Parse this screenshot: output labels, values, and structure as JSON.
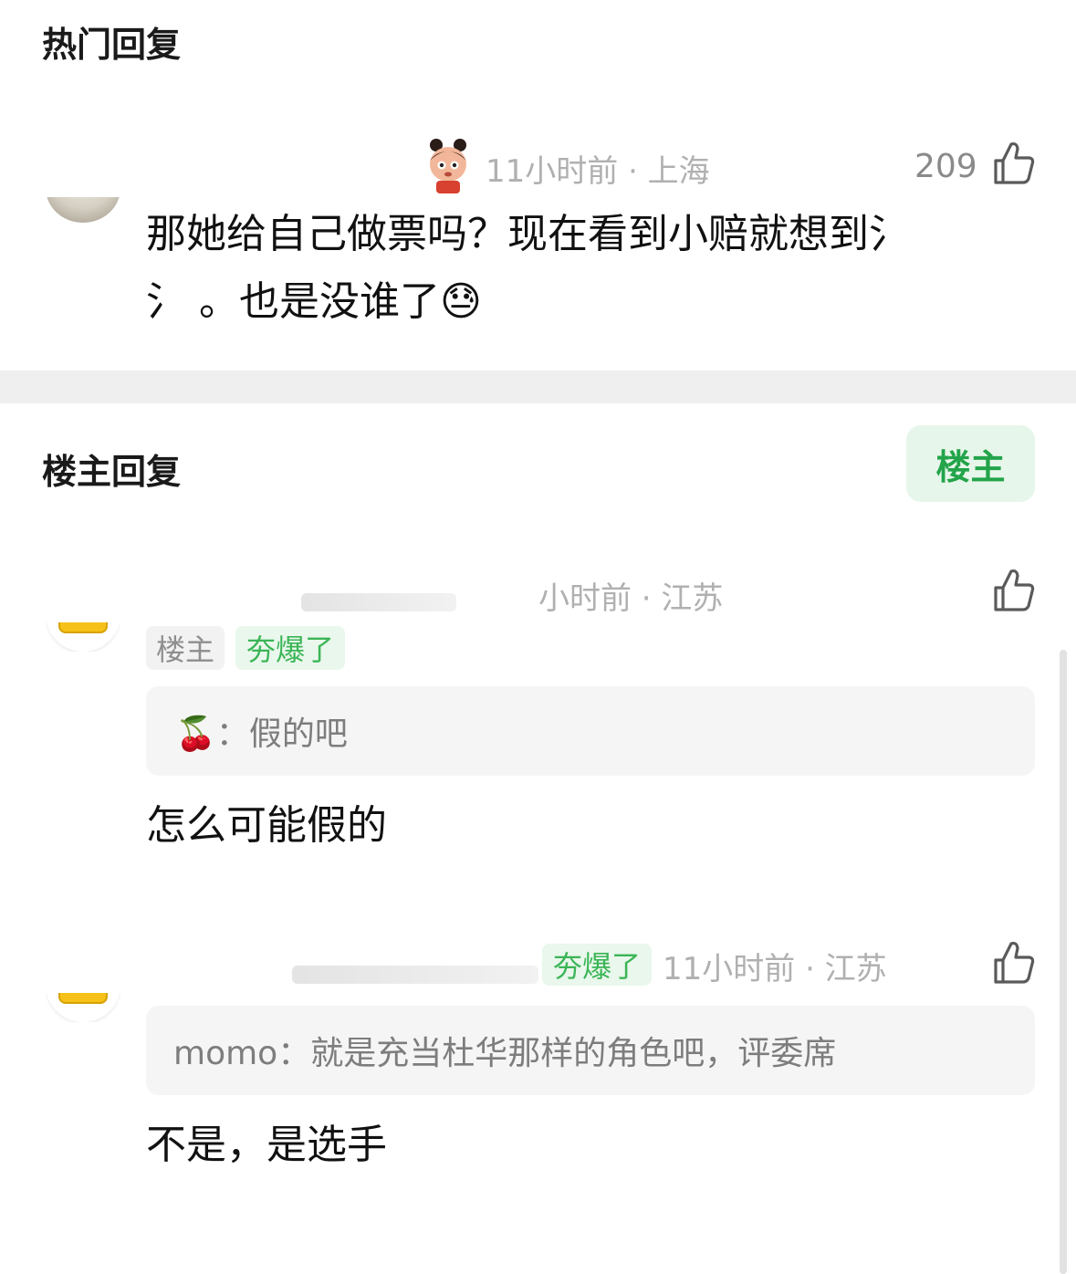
{
  "hot_section": {
    "title": "热门回复",
    "comment": {
      "meta": "11小时前 · 上海",
      "likes": "209",
      "text_line1": "那她给自己做票吗？现在看到小赔就想到氵",
      "text_line2": "氵 。也是没谁了😓"
    }
  },
  "op_section": {
    "title": "楼主回复",
    "filter_button": "楼主",
    "replies": [
      {
        "meta": "小时前 · 江苏",
        "tag_op": "楼主",
        "tag_badge": "夯爆了",
        "quote_text": "🍒：假的吧",
        "text": "怎么可能假的"
      },
      {
        "meta": "11小时前 · 江苏",
        "tag_badge": "夯爆了",
        "quote_text": "momo：就是充当杜华那样的角色吧，评委席",
        "text": "不是，是选手"
      }
    ]
  },
  "colors": {
    "accent_green": "#23a44a",
    "filter_bg": "#e7f6ea",
    "divider": "#efefef"
  }
}
